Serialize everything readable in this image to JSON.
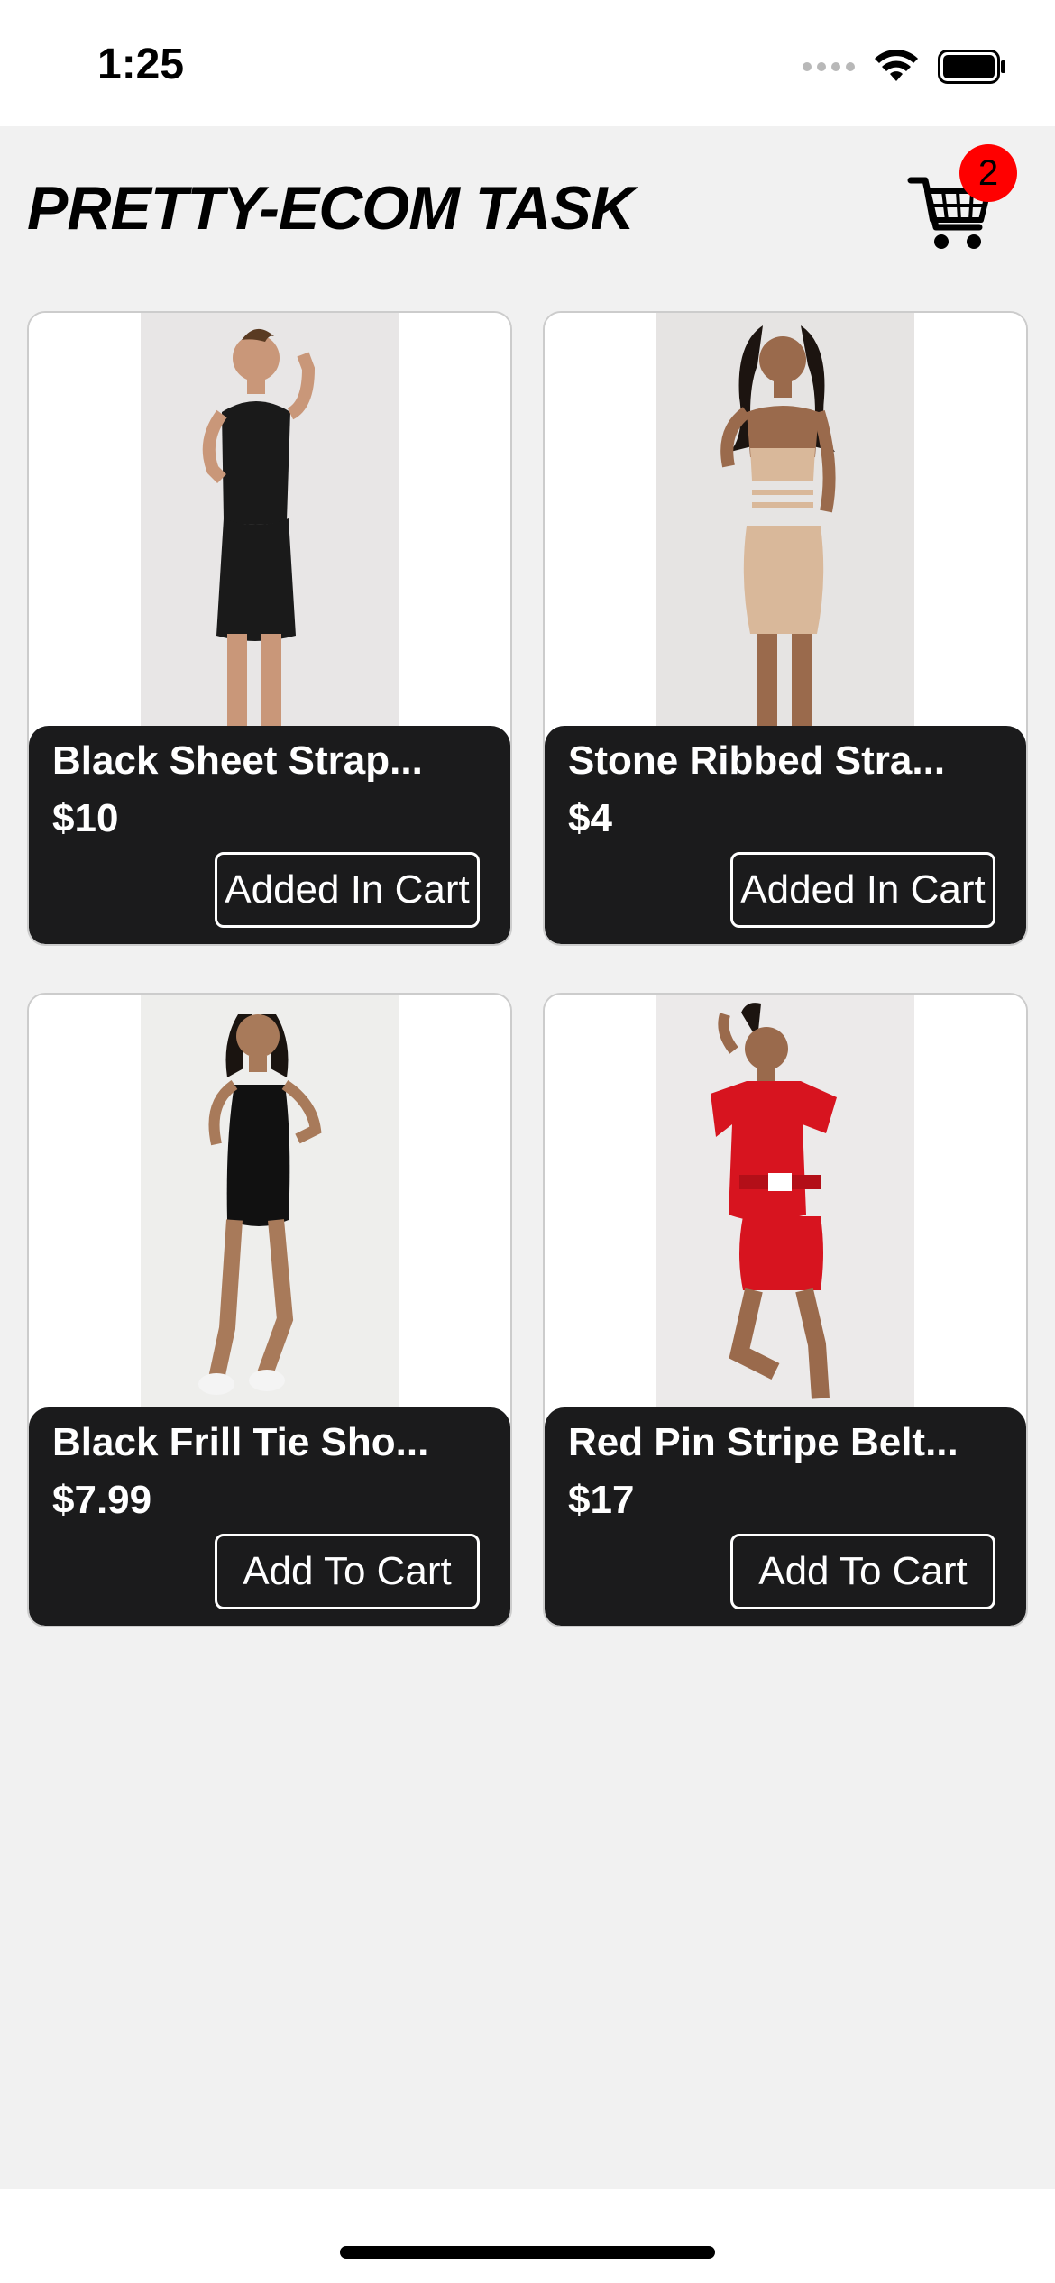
{
  "status_bar": {
    "time": "1:25"
  },
  "header": {
    "title": "PRETTY-ECOM TASK",
    "cart_count": "2"
  },
  "products": [
    {
      "name": "Black Sheet Strap...",
      "price": "$10",
      "action": "Added In Cart",
      "dress_color": "#1a1a1a"
    },
    {
      "name": "Stone Ribbed Stra...",
      "price": "$4",
      "action": "Added In Cart",
      "dress_color": "#d9b89a"
    },
    {
      "name": "Black Frill Tie Sho...",
      "price": "$7.99",
      "action": "Add To Cart",
      "dress_color": "#111111"
    },
    {
      "name": "Red Pin Stripe Belt...",
      "price": "$17",
      "action": "Add To Cart",
      "dress_color": "#d7141f"
    }
  ],
  "colors": {
    "badge": "#ff0000",
    "card_info_bg": "#1b1b1c",
    "page_bg": "#f1f1f1"
  }
}
